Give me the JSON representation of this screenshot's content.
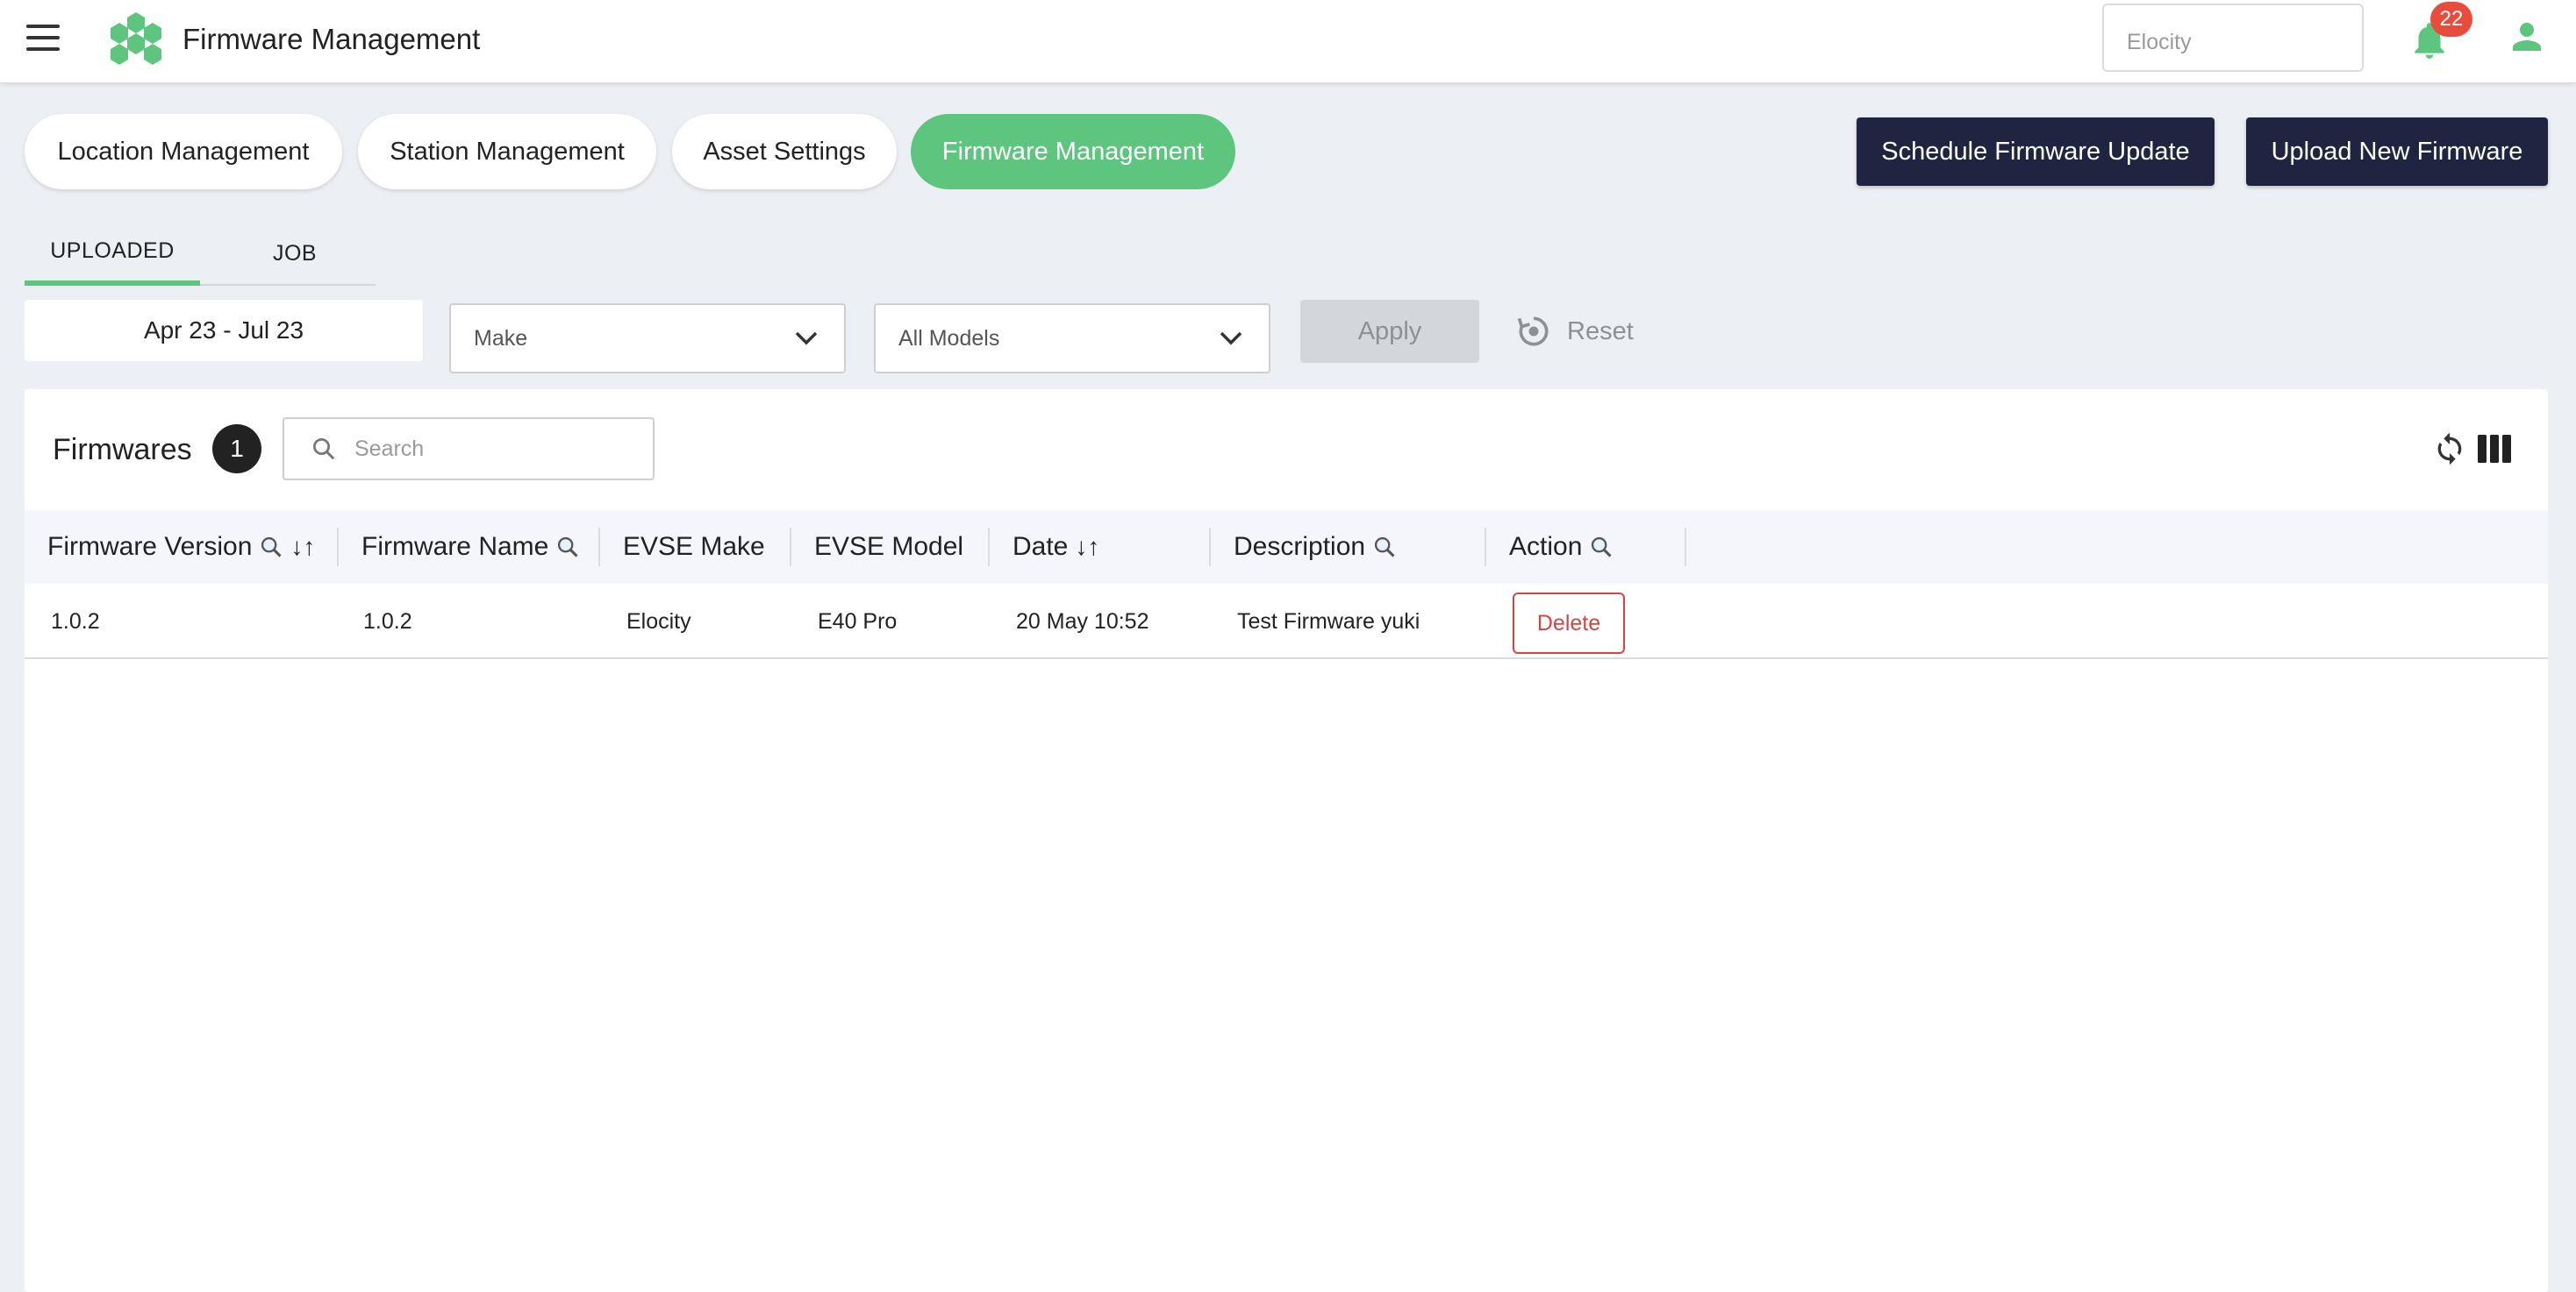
{
  "header": {
    "app_title": "Firmware Management",
    "tenant_value": "Elocity",
    "notification_count": "22",
    "brand_color": "#5dc57e"
  },
  "nav": {
    "tabs": [
      {
        "label": "Location Management",
        "active": false
      },
      {
        "label": "Station Management",
        "active": false
      },
      {
        "label": "Asset Settings",
        "active": false
      },
      {
        "label": "Firmware Management",
        "active": true
      }
    ],
    "schedule_button": "Schedule Firmware Update",
    "upload_button": "Upload New Firmware"
  },
  "subtabs": [
    {
      "label": "UPLOADED",
      "active": true
    },
    {
      "label": "JOB",
      "active": false
    }
  ],
  "filters": {
    "date_range": "Apr 23 - Jul 23",
    "make_placeholder": "Make",
    "model_value": "All Models",
    "apply_label": "Apply",
    "reset_label": "Reset"
  },
  "table_card": {
    "title": "Firmwares",
    "count": "1",
    "search_placeholder": "Search",
    "columns": [
      {
        "label": "Firmware Version",
        "search": true,
        "sort": true
      },
      {
        "label": "Firmware Name",
        "search": true,
        "sort": false
      },
      {
        "label": "EVSE Make",
        "search": false,
        "sort": false
      },
      {
        "label": "EVSE Model",
        "search": false,
        "sort": false
      },
      {
        "label": "Date",
        "search": false,
        "sort": true
      },
      {
        "label": "Description",
        "search": true,
        "sort": false
      },
      {
        "label": "Action",
        "search": true,
        "sort": false
      }
    ],
    "sort_glyph": "↓↑",
    "rows": [
      {
        "firmware_version": "1.0.2",
        "firmware_name": "1.0.2",
        "evse_make": "Elocity",
        "evse_model": "E40 Pro",
        "date": "20 May 10:52",
        "description": "Test Firmware yuki",
        "action": "Delete"
      }
    ]
  },
  "colors": {
    "accent_green": "#5dc57e",
    "dark_navy": "#1f2440",
    "danger_red": "#d64545",
    "badge_red": "#e74c3c"
  }
}
